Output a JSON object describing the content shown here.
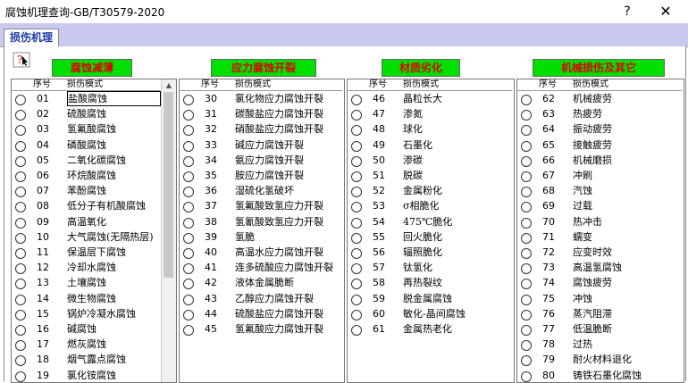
{
  "window": {
    "title": "腐蚀机理查询-GB/T30579-2020",
    "help": "?",
    "close": "✕"
  },
  "tab": {
    "label": "损伤机理"
  },
  "columns": [
    {
      "header": "腐蚀减薄",
      "col_num": "序号",
      "col_mode": "损伤模式",
      "rows": [
        [
          "01",
          "盐酸腐蚀"
        ],
        [
          "02",
          "硫酸腐蚀"
        ],
        [
          "03",
          "氢氟酸腐蚀"
        ],
        [
          "04",
          "磷酸腐蚀"
        ],
        [
          "05",
          "二氧化碳腐蚀"
        ],
        [
          "06",
          "环烷酸腐蚀"
        ],
        [
          "07",
          "苯酚腐蚀"
        ],
        [
          "08",
          "低分子有机酸腐蚀"
        ],
        [
          "09",
          "高温氧化"
        ],
        [
          "10",
          "大气腐蚀(无隔热层)"
        ],
        [
          "11",
          "保温层下腐蚀"
        ],
        [
          "12",
          "冷却水腐蚀"
        ],
        [
          "13",
          "土壤腐蚀"
        ],
        [
          "14",
          "微生物腐蚀"
        ],
        [
          "15",
          "锅炉冷凝水腐蚀"
        ],
        [
          "16",
          "碱腐蚀"
        ],
        [
          "17",
          "燃灰腐蚀"
        ],
        [
          "18",
          "烟气露点腐蚀"
        ],
        [
          "19",
          "氯化铵腐蚀"
        ]
      ]
    },
    {
      "header": "应力腐蚀开裂",
      "col_num": "序号",
      "col_mode": "损伤模式",
      "rows": [
        [
          "30",
          "氯化物应力腐蚀开裂"
        ],
        [
          "31",
          "碳酸盐应力腐蚀开裂"
        ],
        [
          "32",
          "硝酸盐应力腐蚀开裂"
        ],
        [
          "33",
          "碱应力腐蚀开裂"
        ],
        [
          "34",
          "氨应力腐蚀开裂"
        ],
        [
          "35",
          "胺应力腐蚀开裂"
        ],
        [
          "36",
          "湿硫化氢破坏"
        ],
        [
          "37",
          "氢氟酸致氢应力开裂"
        ],
        [
          "38",
          "氢氰酸致氢应力开裂"
        ],
        [
          "39",
          "氢脆"
        ],
        [
          "40",
          "高温水应力腐蚀开裂"
        ],
        [
          "41",
          "连多硫酸应力腐蚀开裂"
        ],
        [
          "42",
          "液体金属脆断"
        ],
        [
          "43",
          "乙醇应力腐蚀开裂"
        ],
        [
          "44",
          "硫酸盐应力腐蚀开裂"
        ],
        [
          "45",
          "氢氟酸应力腐蚀开裂"
        ]
      ]
    },
    {
      "header": "材质劣化",
      "col_num": "序号",
      "col_mode": "损伤模式",
      "rows": [
        [
          "46",
          "晶粒长大"
        ],
        [
          "47",
          "渗氮"
        ],
        [
          "48",
          "球化"
        ],
        [
          "49",
          "石墨化"
        ],
        [
          "50",
          "渗碳"
        ],
        [
          "51",
          "脱碳"
        ],
        [
          "52",
          "金属粉化"
        ],
        [
          "53",
          "σ相脆化"
        ],
        [
          "54",
          "475℃脆化"
        ],
        [
          "55",
          "回火脆化"
        ],
        [
          "56",
          "辐照脆化"
        ],
        [
          "57",
          "钛氢化"
        ],
        [
          "58",
          "再热裂纹"
        ],
        [
          "59",
          "脱金属腐蚀"
        ],
        [
          "60",
          "敏化-晶间腐蚀"
        ],
        [
          "61",
          "金属热老化"
        ]
      ]
    },
    {
      "header": "机械损伤及其它",
      "col_num": "序号",
      "col_mode": "损伤模式",
      "rows": [
        [
          "62",
          "机械疲劳"
        ],
        [
          "63",
          "热疲劳"
        ],
        [
          "64",
          "振动疲劳"
        ],
        [
          "65",
          "接触疲劳"
        ],
        [
          "66",
          "机械磨损"
        ],
        [
          "67",
          "冲刷"
        ],
        [
          "68",
          "汽蚀"
        ],
        [
          "69",
          "过载"
        ],
        [
          "70",
          "热冲击"
        ],
        [
          "71",
          "蠕变"
        ],
        [
          "72",
          "应变时效"
        ],
        [
          "73",
          "高温氢腐蚀"
        ],
        [
          "74",
          "腐蚀疲劳"
        ],
        [
          "75",
          "冲蚀"
        ],
        [
          "76",
          "蒸汽阻滞"
        ],
        [
          "77",
          "低温脆断"
        ],
        [
          "78",
          "过热"
        ],
        [
          "79",
          "耐火材料退化"
        ],
        [
          "80",
          "铸铁石墨化腐蚀"
        ]
      ]
    }
  ]
}
